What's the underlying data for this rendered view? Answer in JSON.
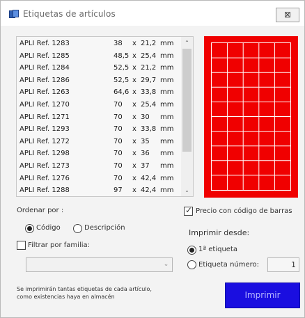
{
  "window": {
    "title": "Etiquetas de artículos",
    "close_label": "⊠"
  },
  "list": {
    "rows": [
      {
        "name": "APLI Ref. 1283",
        "w": "38",
        "x": "x",
        "h": "21,2",
        "unit": "mm"
      },
      {
        "name": "APLI Ref. 1285",
        "w": "48,5",
        "x": "x",
        "h": "25,4",
        "unit": "mm"
      },
      {
        "name": "APLI Ref. 1284",
        "w": "52,5",
        "x": "x",
        "h": "21,2",
        "unit": "mm"
      },
      {
        "name": "APLI Ref. 1286",
        "w": "52,5",
        "x": "x",
        "h": "29,7",
        "unit": "mm"
      },
      {
        "name": "APLI Ref. 1263",
        "w": "64,6",
        "x": "x",
        "h": "33,8",
        "unit": "mm"
      },
      {
        "name": "APLI Ref. 1270",
        "w": "70",
        "x": "x",
        "h": "25,4",
        "unit": "mm"
      },
      {
        "name": "APLI Ref. 1271",
        "w": "70",
        "x": "x",
        "h": "30",
        "unit": "mm"
      },
      {
        "name": "APLI Ref. 1293",
        "w": "70",
        "x": "x",
        "h": "33,8",
        "unit": "mm"
      },
      {
        "name": "APLI Ref. 1272",
        "w": "70",
        "x": "x",
        "h": "35",
        "unit": "mm"
      },
      {
        "name": "APLI Ref. 1298",
        "w": "70",
        "x": "x",
        "h": "36",
        "unit": "mm"
      },
      {
        "name": "APLI Ref. 1273",
        "w": "70",
        "x": "x",
        "h": "37",
        "unit": "mm"
      },
      {
        "name": "APLI Ref. 1276",
        "w": "70",
        "x": "x",
        "h": "42,4",
        "unit": "mm"
      },
      {
        "name": "APLI Ref. 1288",
        "w": "97",
        "x": "x",
        "h": "42,4",
        "unit": "mm"
      }
    ],
    "scroll_up": "⌃",
    "scroll_down": "⌄"
  },
  "preview": {
    "columns": 5,
    "rows": 10,
    "color": "#f00000"
  },
  "ordenar": {
    "label": "Ordenar por :",
    "codigo_label": "Código",
    "descripcion_label": "Descripción",
    "selected": "codigo"
  },
  "filtrar": {
    "label": "Filtrar por familia:",
    "checked": false,
    "combo_value": "",
    "arrow": "⌄"
  },
  "precio": {
    "label": "Precio con código de barras",
    "checked": true
  },
  "imprimir_desde": {
    "label": "Imprimir desde:",
    "primera_label": "1ª etiqueta",
    "numero_label": "Etiqueta número:",
    "numero_value": "1",
    "selected": "primera"
  },
  "note": "Se imprimirán tantas etiquetas de cada artículo, como existencias haya en almacén",
  "print_button": "Imprimir",
  "colors": {
    "accent": "#1a0ee0",
    "preview_red": "#f00000"
  }
}
